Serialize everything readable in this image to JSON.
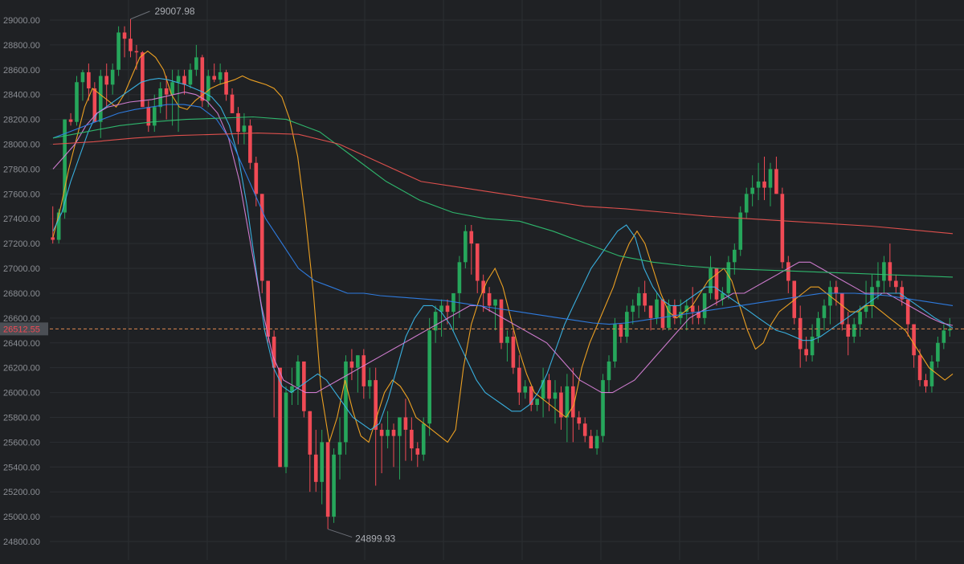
{
  "chart_data": {
    "type": "candlestick",
    "ylim": [
      24800,
      29100
    ],
    "y_ticks": [
      "29000.00",
      "28800.00",
      "28600.00",
      "28400.00",
      "28200.00",
      "28000.00",
      "27800.00",
      "27600.00",
      "27400.00",
      "27200.00",
      "27000.00",
      "26800.00",
      "26600.00",
      "26400.00",
      "26200.00",
      "26000.00",
      "25800.00",
      "25600.00",
      "25400.00",
      "25200.00",
      "25000.00",
      "24800.00"
    ],
    "grid": true,
    "colors": {
      "up": "#26a65b",
      "down": "#f04a55",
      "background": "#1f2124",
      "grid": "#2b2e32",
      "axis_text": "#8a8d93",
      "price_line": "#e0894f"
    },
    "annotations": {
      "high_label": "29007.98",
      "low_label": "24899.93"
    },
    "last_price": {
      "value": 26512.55,
      "label": "26512.55"
    },
    "candles": [
      [
        27250,
        27500,
        27200,
        27230
      ],
      [
        27230,
        27480,
        27200,
        27450
      ],
      [
        27450,
        28200,
        27400,
        28200
      ],
      [
        28200,
        28250,
        28150,
        28180
      ],
      [
        28180,
        28550,
        28150,
        28500
      ],
      [
        28500,
        28600,
        28350,
        28580
      ],
      [
        28580,
        28650,
        28350,
        28450
      ],
      [
        28450,
        28500,
        28200,
        28180
      ],
      [
        28180,
        28600,
        28050,
        28550
      ],
      [
        28550,
        28650,
        28300,
        28480
      ],
      [
        28480,
        28650,
        28400,
        28600
      ],
      [
        28600,
        28950,
        28550,
        28900
      ],
      [
        28900,
        28950,
        28700,
        28850
      ],
      [
        28850,
        29008,
        28700,
        28750
      ],
      [
        28750,
        28800,
        28600,
        28740
      ],
      [
        28740,
        28750,
        28300,
        28300
      ],
      [
        28300,
        28350,
        28100,
        28150
      ],
      [
        28150,
        28400,
        28100,
        28300
      ],
      [
        28300,
        28500,
        28250,
        28450
      ],
      [
        28450,
        28550,
        28200,
        28400
      ],
      [
        28400,
        28600,
        28150,
        28500
      ],
      [
        28500,
        28600,
        28100,
        28550
      ],
      [
        28550,
        28600,
        28400,
        28480
      ],
      [
        28480,
        28650,
        28450,
        28600
      ],
      [
        28600,
        28800,
        28550,
        28700
      ],
      [
        28700,
        28720,
        28300,
        28350
      ],
      [
        28350,
        28600,
        28300,
        28550
      ],
      [
        28550,
        28650,
        28500,
        28520
      ],
      [
        28520,
        28650,
        28480,
        28580
      ],
      [
        28580,
        28600,
        28350,
        28400
      ],
      [
        28400,
        28450,
        28300,
        28250
      ],
      [
        28250,
        28300,
        28000,
        28100
      ],
      [
        28100,
        28250,
        28000,
        28150
      ],
      [
        28150,
        28200,
        27800,
        27850
      ],
      [
        27850,
        27900,
        27500,
        27600
      ],
      [
        27600,
        27100,
        26800,
        26900
      ],
      [
        26900,
        26700,
        26400,
        26450
      ],
      [
        26450,
        26500,
        25800,
        26200
      ],
      [
        26200,
        26200,
        25500,
        25400
      ],
      [
        25400,
        26050,
        25350,
        26000
      ],
      [
        26000,
        26200,
        25900,
        26050
      ],
      [
        26050,
        26300,
        25900,
        26250
      ],
      [
        26250,
        26250,
        25800,
        25850
      ],
      [
        25850,
        25700,
        25200,
        25500
      ],
      [
        25500,
        25700,
        25200,
        25280
      ],
      [
        25280,
        25700,
        25100,
        25600
      ],
      [
        25600,
        25600,
        24900,
        25000
      ],
      [
        25000,
        25550,
        24950,
        25500
      ],
      [
        25500,
        25800,
        25300,
        25600
      ],
      [
        25600,
        26300,
        25500,
        26250
      ],
      [
        26250,
        26350,
        26100,
        26200
      ],
      [
        26200,
        26300,
        26000,
        26300
      ],
      [
        26300,
        26350,
        25950,
        26050
      ],
      [
        26050,
        26200,
        25950,
        26100
      ],
      [
        26100,
        26200,
        25250,
        25700
      ],
      [
        25700,
        25750,
        25350,
        25650
      ],
      [
        25650,
        25850,
        25550,
        25700
      ],
      [
        25700,
        25750,
        25400,
        25650
      ],
      [
        25650,
        25800,
        25300,
        25800
      ],
      [
        25800,
        25950,
        25450,
        25700
      ],
      [
        25700,
        25800,
        25450,
        25550
      ],
      [
        25550,
        25600,
        25400,
        25500
      ],
      [
        25500,
        25800,
        25450,
        25750
      ],
      [
        25750,
        26600,
        25650,
        26500
      ],
      [
        26500,
        26700,
        26400,
        26650
      ],
      [
        26650,
        26750,
        26450,
        26700
      ],
      [
        26700,
        26750,
        26550,
        26650
      ],
      [
        26650,
        26800,
        26500,
        26800
      ],
      [
        26800,
        27100,
        26600,
        27050
      ],
      [
        27050,
        27350,
        27000,
        27300
      ],
      [
        27300,
        27350,
        26950,
        27200
      ],
      [
        27200,
        27100,
        26800,
        26900
      ],
      [
        26900,
        26950,
        26650,
        26800
      ],
      [
        26800,
        26850,
        26650,
        26700
      ],
      [
        26700,
        26750,
        26500,
        26750
      ],
      [
        26750,
        26650,
        26350,
        26400
      ],
      [
        26400,
        26500,
        26250,
        26450
      ],
      [
        26450,
        26500,
        26150,
        26200
      ],
      [
        26200,
        26300,
        25900,
        26000
      ],
      [
        26000,
        26100,
        25950,
        26050
      ],
      [
        26050,
        26000,
        25850,
        25900
      ],
      [
        25900,
        25950,
        25850,
        25950
      ],
      [
        25950,
        26200,
        25800,
        26100
      ],
      [
        26100,
        26150,
        25850,
        25950
      ],
      [
        25950,
        26100,
        25750,
        26000
      ],
      [
        26000,
        26050,
        25700,
        25800
      ],
      [
        25800,
        26150,
        25600,
        26050
      ],
      [
        26050,
        26200,
        25600,
        25800
      ],
      [
        25800,
        25850,
        25700,
        25750
      ],
      [
        25750,
        25800,
        25600,
        25650
      ],
      [
        25650,
        25700,
        25550,
        25550
      ],
      [
        25550,
        25700,
        25500,
        25650
      ],
      [
        25650,
        26150,
        25600,
        26100
      ],
      [
        26100,
        26300,
        26000,
        26250
      ],
      [
        26250,
        26600,
        26200,
        26550
      ],
      [
        26550,
        26500,
        26400,
        26450
      ],
      [
        26450,
        26700,
        26400,
        26650
      ],
      [
        26650,
        26750,
        26550,
        26700
      ],
      [
        26700,
        26850,
        26600,
        26800
      ],
      [
        26800,
        26900,
        26650,
        26700
      ],
      [
        26700,
        26650,
        26500,
        26600
      ],
      [
        26600,
        26800,
        26550,
        26750
      ],
      [
        26750,
        26700,
        26500,
        26520
      ],
      [
        26520,
        26750,
        26500,
        26700
      ],
      [
        26700,
        26750,
        26550,
        26600
      ],
      [
        26600,
        26750,
        26550,
        26650
      ],
      [
        26650,
        26750,
        26500,
        26700
      ],
      [
        26700,
        26850,
        26550,
        26650
      ],
      [
        26650,
        26700,
        26550,
        26600
      ],
      [
        26600,
        26800,
        26550,
        26800
      ],
      [
        26800,
        27100,
        26750,
        27000
      ],
      [
        27000,
        26950,
        26700,
        26750
      ],
      [
        26750,
        26850,
        26700,
        26800
      ],
      [
        26800,
        27100,
        26750,
        27050
      ],
      [
        27050,
        27200,
        26950,
        27150
      ],
      [
        27150,
        27500,
        27100,
        27450
      ],
      [
        27450,
        27650,
        27400,
        27600
      ],
      [
        27600,
        27750,
        27500,
        27650
      ],
      [
        27650,
        27850,
        27550,
        27700
      ],
      [
        27700,
        27900,
        27550,
        27650
      ],
      [
        27650,
        27850,
        27500,
        27800
      ],
      [
        27800,
        27900,
        27600,
        27600
      ],
      [
        27600,
        27650,
        27000,
        27050
      ],
      [
        27050,
        27100,
        26800,
        26900
      ],
      [
        26900,
        26800,
        26550,
        26600
      ],
      [
        26600,
        26700,
        26200,
        26350
      ],
      [
        26350,
        26450,
        26250,
        26300
      ],
      [
        26300,
        26550,
        26250,
        26450
      ],
      [
        26450,
        26650,
        26400,
        26600
      ],
      [
        26600,
        26750,
        26500,
        26700
      ],
      [
        26700,
        26900,
        26550,
        26850
      ],
      [
        26850,
        26900,
        26700,
        26800
      ],
      [
        26800,
        26750,
        26500,
        26550
      ],
      [
        26550,
        26650,
        26300,
        26450
      ],
      [
        26450,
        26600,
        26400,
        26550
      ],
      [
        26550,
        26700,
        26450,
        26650
      ],
      [
        26650,
        26900,
        26600,
        26700
      ],
      [
        26700,
        26950,
        26600,
        26850
      ],
      [
        26850,
        27050,
        26750,
        26900
      ],
      [
        26900,
        27100,
        26800,
        27050
      ],
      [
        27050,
        27200,
        26850,
        26900
      ],
      [
        26900,
        26950,
        26800,
        26850
      ],
      [
        26850,
        26900,
        26700,
        26750
      ],
      [
        26750,
        26700,
        26450,
        26550
      ],
      [
        26550,
        26500,
        26200,
        26300
      ],
      [
        26300,
        26350,
        26050,
        26100
      ],
      [
        26100,
        26150,
        26000,
        26050
      ],
      [
        26050,
        26300,
        26000,
        26250
      ],
      [
        26250,
        26450,
        26200,
        26400
      ],
      [
        26400,
        26550,
        26350,
        26500
      ],
      [
        26500,
        26600,
        26450,
        26512
      ]
    ],
    "ma_lines": [
      {
        "color": "#f5a623",
        "values": [
          27250,
          27500,
          27800,
          28050,
          28300,
          28450,
          28400,
          28350,
          28300,
          28400,
          28550,
          28700,
          28750,
          28700,
          28600,
          28400,
          28300,
          28280,
          28350,
          28400,
          28450,
          28480,
          28500,
          28520,
          28550,
          28520,
          28500,
          28480,
          28450,
          28380,
          28200,
          27900,
          27400,
          26800,
          26000,
          25600,
          25800,
          26100,
          25850,
          25650,
          25600,
          25800,
          26000,
          26100,
          26050,
          25950,
          25800,
          25750,
          25700,
          25650,
          25600,
          25700,
          26200,
          26550,
          26750,
          26900,
          27000,
          26850,
          26600,
          26350,
          26150,
          26000,
          25950,
          25900,
          25850,
          25800,
          25900,
          26200,
          26400,
          26550,
          26700,
          26850,
          27050,
          27200,
          27300,
          27200,
          27000,
          26800,
          26650,
          26600,
          26650,
          26700,
          26800,
          26900,
          26950,
          27000,
          26900,
          26700,
          26500,
          26350,
          26400,
          26550,
          26650,
          26700,
          26750,
          26800,
          26850,
          26850,
          26800,
          26750,
          26700,
          26650,
          26650,
          26700,
          26700,
          26650,
          26600,
          26550,
          26500,
          26400,
          26300,
          26200,
          26150,
          26100,
          26150
        ]
      },
      {
        "color": "#3ab6e8",
        "values": [
          27300,
          27450,
          27700,
          27900,
          28100,
          28250,
          28300,
          28350,
          28400,
          28450,
          28500,
          28520,
          28530,
          28520,
          28500,
          28480,
          28450,
          28420,
          28380,
          28300,
          28150,
          27900,
          27500,
          27000,
          26500,
          26200,
          26050,
          26000,
          26050,
          26100,
          26150,
          26100,
          26000,
          25900,
          25800,
          25750,
          25700,
          25750,
          25950,
          26200,
          26450,
          26600,
          26700,
          26700,
          26650,
          26550,
          26400,
          26250,
          26100,
          26000,
          25950,
          25900,
          25850,
          25850,
          25900,
          26000,
          26150,
          26350,
          26550,
          26700,
          26850,
          27000,
          27100,
          27200,
          27300,
          27350,
          27250,
          27000,
          26850,
          26750,
          26700,
          26700,
          26750,
          26800,
          26850,
          26850,
          26800,
          26750,
          26700,
          26650,
          26600,
          26550,
          26500,
          26480,
          26450,
          26420,
          26420,
          26450,
          26500,
          26550,
          26600,
          26650,
          26700,
          26750,
          26800,
          26800,
          26800,
          26750,
          26700,
          26650,
          26600,
          26560,
          26520
        ]
      },
      {
        "color": "#d67fd6",
        "values": [
          27800,
          27900,
          28000,
          28150,
          28250,
          28300,
          28320,
          28340,
          28350,
          28360,
          28380,
          28400,
          28420,
          28400,
          28350,
          28250,
          28050,
          27700,
          27200,
          26700,
          26300,
          26100,
          26050,
          26000,
          26000,
          26050,
          26100,
          26150,
          26200,
          26250,
          26300,
          26350,
          26400,
          26450,
          26500,
          26550,
          26600,
          26650,
          26700,
          26700,
          26650,
          26600,
          26550,
          26500,
          26450,
          26400,
          26300,
          26200,
          26100,
          26050,
          26000,
          26000,
          26050,
          26100,
          26200,
          26300,
          26400,
          26500,
          26600,
          26650,
          26700,
          26750,
          26800,
          26800,
          26850,
          26900,
          26950,
          27000,
          27050,
          27050,
          27000,
          26950,
          26900,
          26850,
          26800,
          26800,
          26800,
          26750,
          26700,
          26650,
          26600,
          26560,
          26540
        ]
      },
      {
        "color": "#2f7fe8",
        "values": [
          28050,
          28100,
          28150,
          28200,
          28250,
          28280,
          28300,
          28320,
          28320,
          28300,
          28200,
          28000,
          27700,
          27400,
          27200,
          27000,
          26900,
          26850,
          26800,
          26800,
          26780,
          26770,
          26760,
          26750,
          26740,
          26720,
          26700,
          26680,
          26660,
          26640,
          26620,
          26600,
          26580,
          26560,
          26550,
          26560,
          26580,
          26600,
          26620,
          26640,
          26660,
          26680,
          26700,
          26720,
          26740,
          26760,
          26780,
          26800,
          26800,
          26800,
          26790,
          26780,
          26760,
          26740,
          26720,
          26700
        ]
      },
      {
        "color": "#2fbf71",
        "values": [
          28050,
          28100,
          28150,
          28180,
          28200,
          28210,
          28220,
          28200,
          28100,
          27900,
          27700,
          27550,
          27450,
          27400,
          27380,
          27300,
          27200,
          27100,
          27050,
          27020,
          27000,
          26990,
          26980,
          26970,
          26960,
          26950,
          26940,
          26930
        ]
      },
      {
        "color": "#e8524f",
        "values": [
          28000,
          28020,
          28050,
          28070,
          28080,
          28090,
          28080,
          28000,
          27850,
          27700,
          27650,
          27600,
          27550,
          27500,
          27480,
          27450,
          27420,
          27400,
          27380,
          27360,
          27340,
          27310,
          27280
        ]
      }
    ]
  }
}
